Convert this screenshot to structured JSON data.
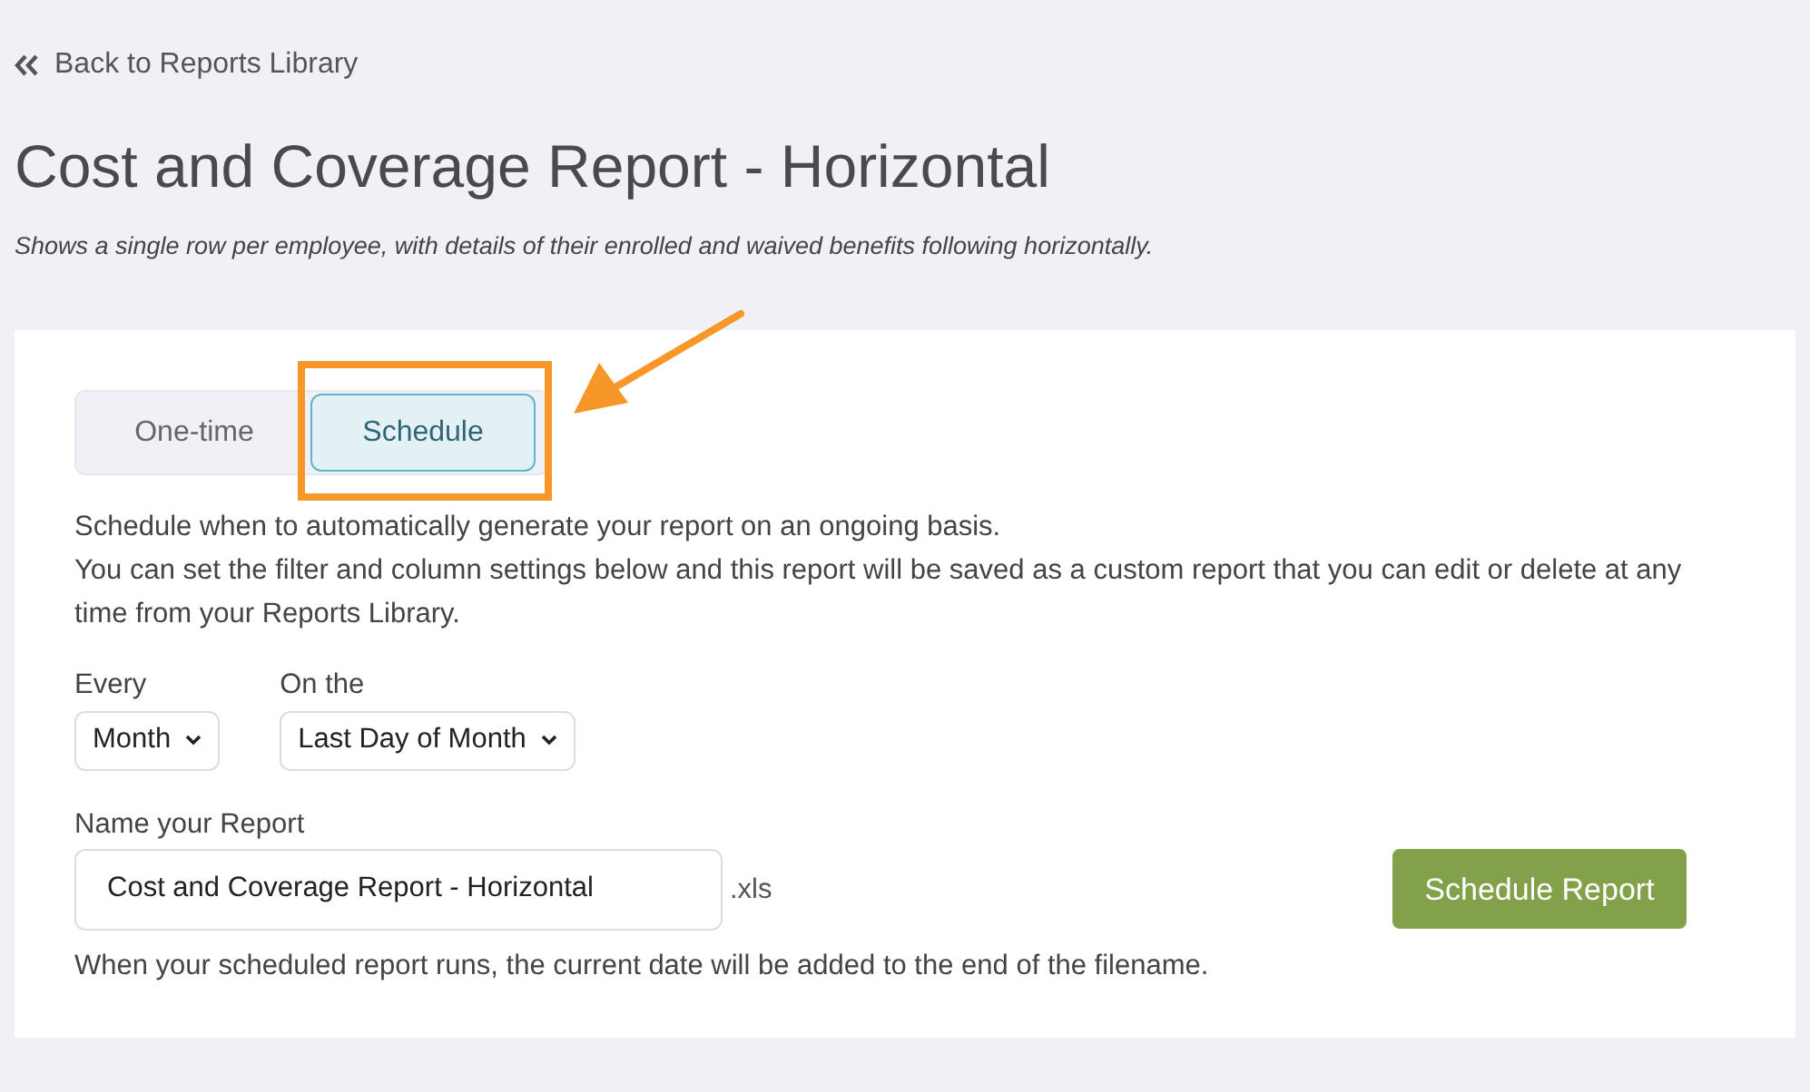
{
  "back_link": {
    "label": "Back to Reports Library"
  },
  "title": "Cost and Coverage Report - Horizontal",
  "subtitle": "Shows a single row per employee, with details of their enrolled and waived benefits following horizontally.",
  "tabs": [
    {
      "label": "One-time",
      "selected": false
    },
    {
      "label": "Schedule",
      "selected": true
    }
  ],
  "description": [
    "Schedule when to automatically generate your report on an ongoing basis.",
    "You can set the filter and column settings below and this report will be saved as a custom report that you can edit or delete at any time from your Reports Library."
  ],
  "selects": [
    {
      "label": "Every",
      "value": "Month"
    },
    {
      "label": "On the",
      "value": "Last Day of Month"
    }
  ],
  "name_field": {
    "label": "Name your Report",
    "value": "Cost and Coverage Report - Horizontal",
    "suffix": ".xls"
  },
  "submit_button": "Schedule Report",
  "footnote": "When your scheduled report runs, the current date will be added to the end of the filename."
}
